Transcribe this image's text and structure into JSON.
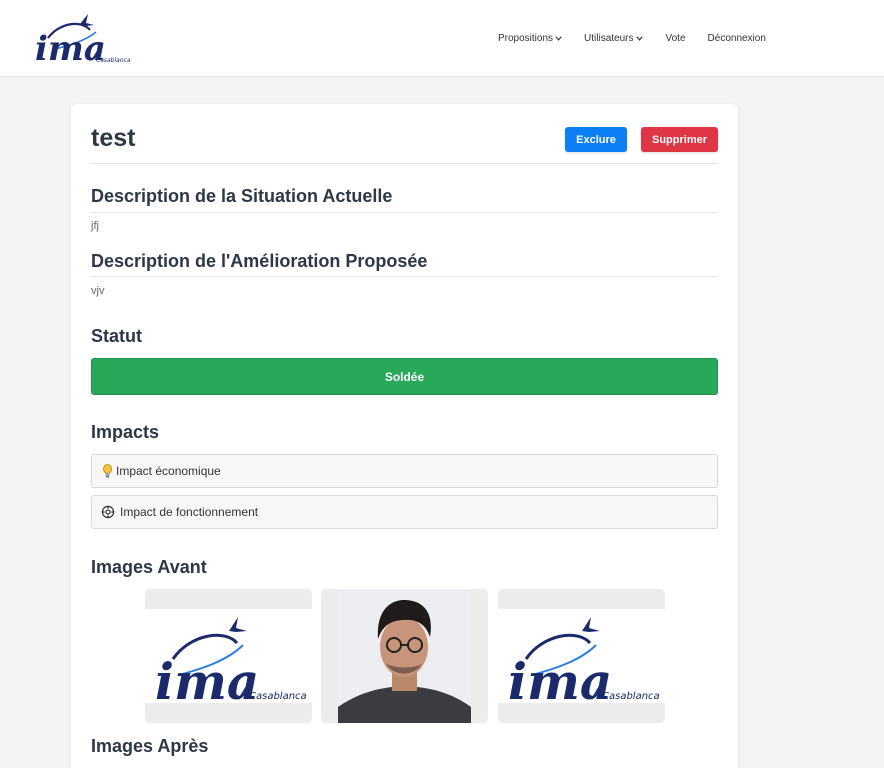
{
  "brand": {
    "logo_text": "ima",
    "logo_sub": "Casablanca"
  },
  "nav": {
    "propositions": "Propositions",
    "utilisateurs": "Utilisateurs",
    "vote": "Vote",
    "deconnexion": "Déconnexion"
  },
  "proposal": {
    "title": "test",
    "exclude_label": "Exclure",
    "delete_label": "Supprimer"
  },
  "situation": {
    "heading": "Description de la Situation Actuelle",
    "text": "jfj"
  },
  "amelioration": {
    "heading": "Description de l'Amélioration Proposée",
    "text": "vjv"
  },
  "statut": {
    "heading": "Statut",
    "value": "Soldée"
  },
  "impacts": {
    "heading": "Impacts",
    "items": [
      {
        "icon": "lightbulb-icon",
        "label": "Impact économique"
      },
      {
        "icon": "gear-icon",
        "label": "Impact de fonctionnement"
      }
    ]
  },
  "images_avant": {
    "heading": "Images Avant"
  },
  "images_apres": {
    "heading": "Images Après"
  },
  "colors": {
    "primary": "#0d7ff5",
    "danger": "#df3545",
    "success": "#29a85a",
    "brand_navy": "#1b2a6b"
  }
}
